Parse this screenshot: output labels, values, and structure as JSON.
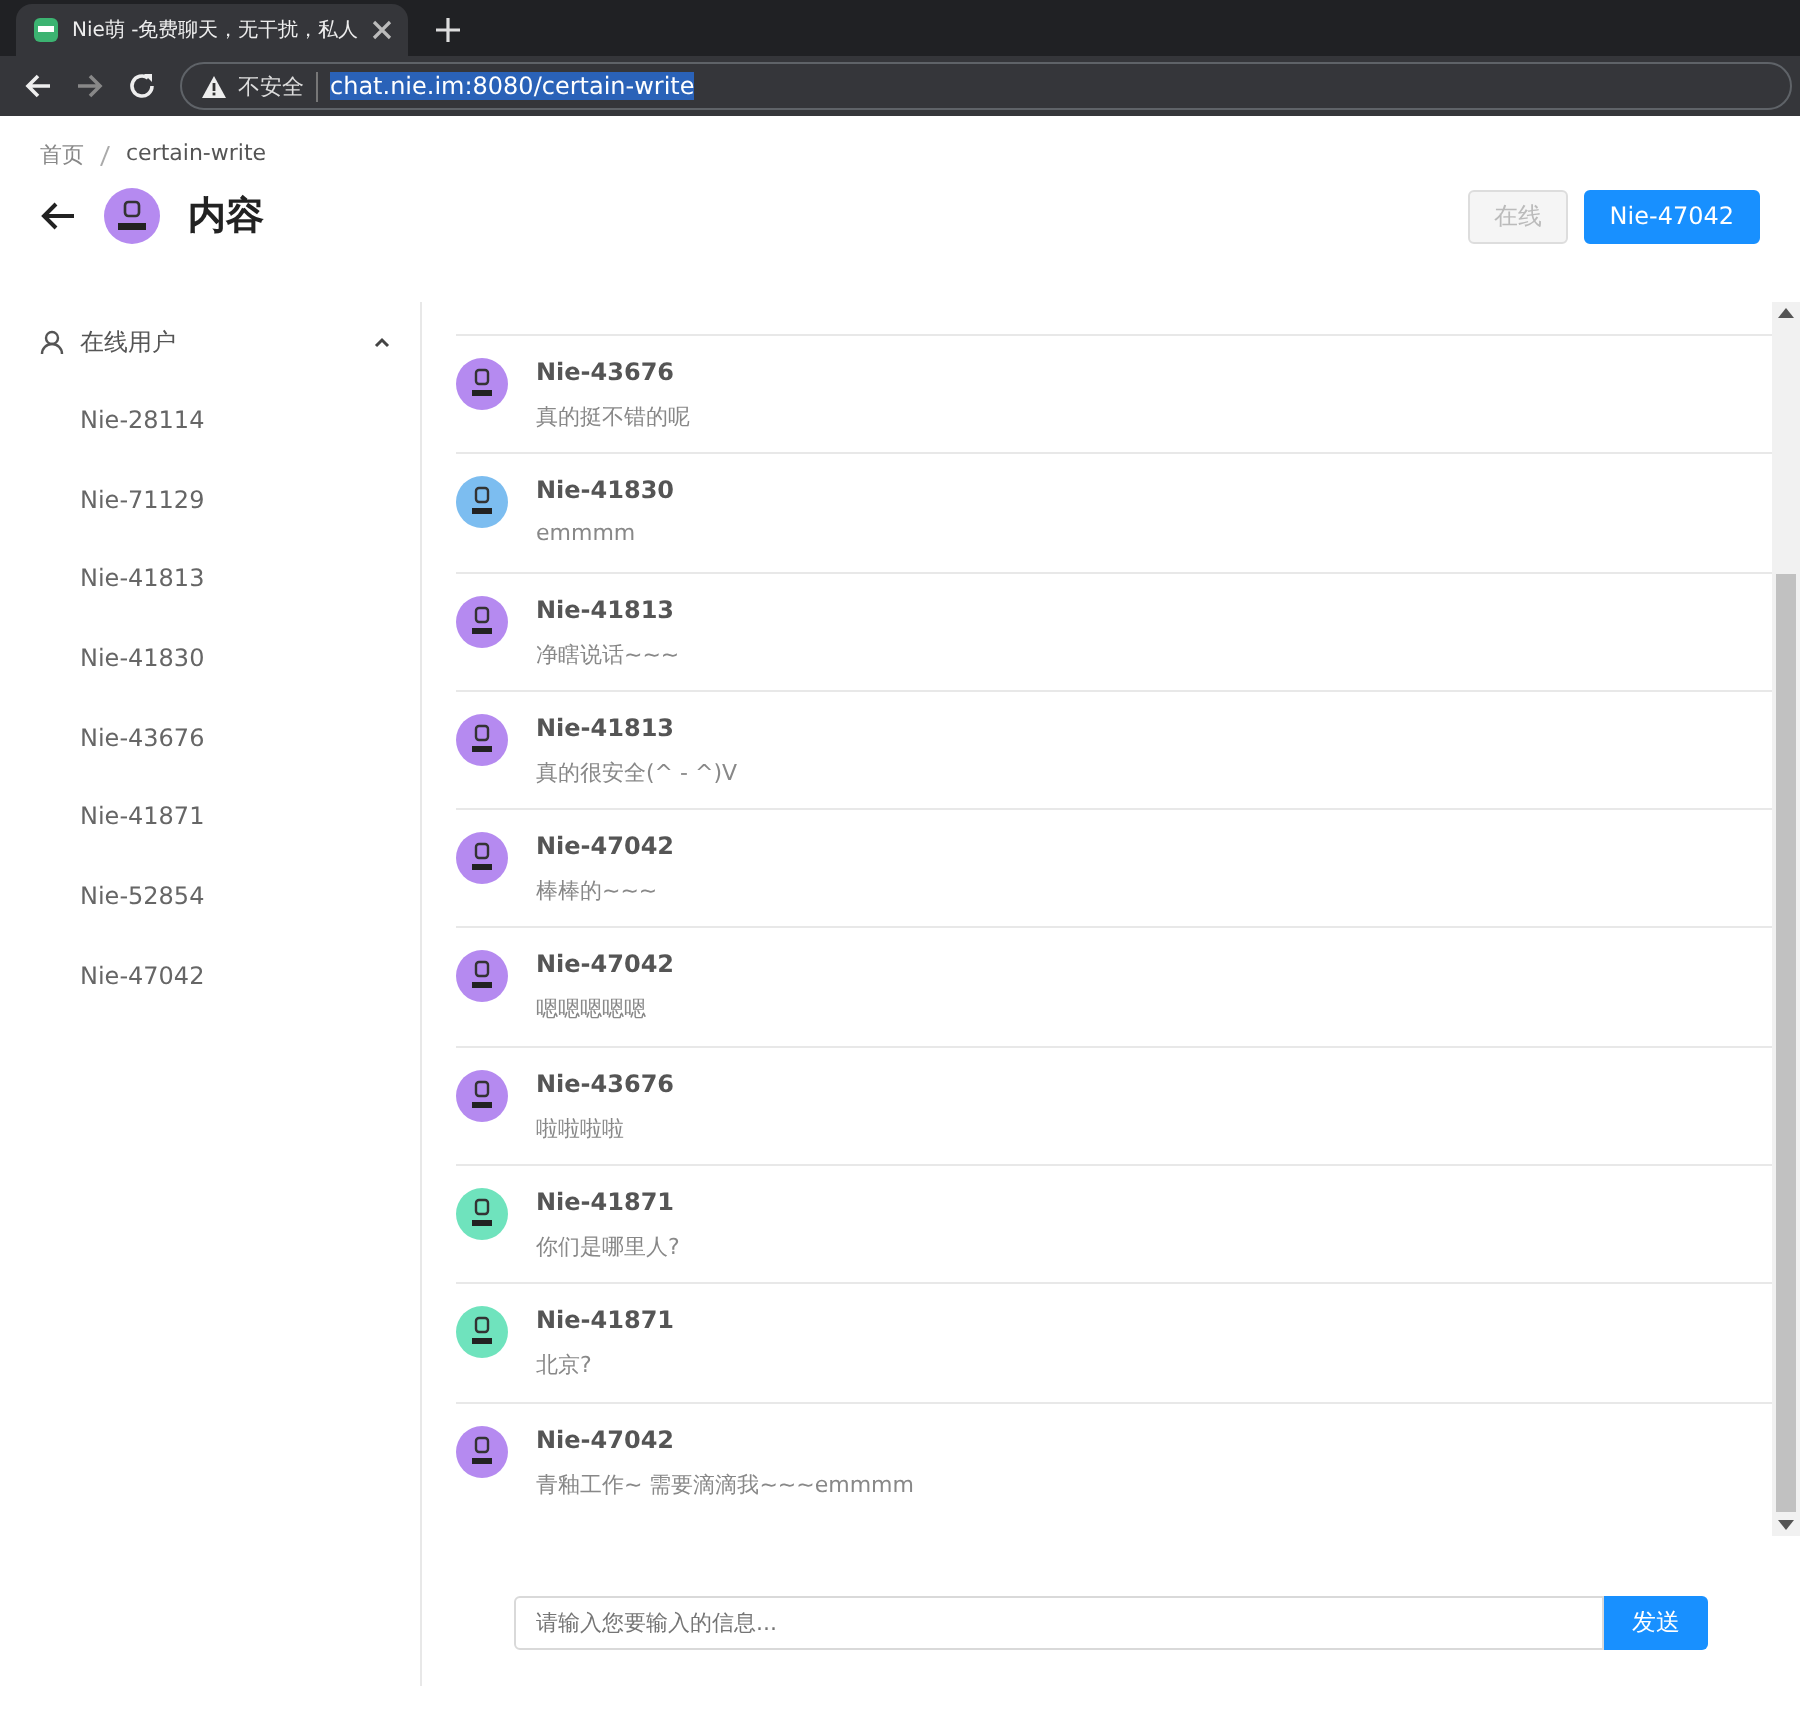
{
  "browser": {
    "tab_title": "Nie萌 -免费聊天，无干扰，私人",
    "security_label": "不安全",
    "url": "chat.nie.im:8080/certain-write"
  },
  "breadcrumb": [
    "首页",
    "certain-write"
  ],
  "header": {
    "title": "内容",
    "buttons": [
      {
        "label": "在线",
        "disabled": true
      },
      {
        "label": "Nie-47042",
        "disabled": false
      }
    ]
  },
  "sidebar": {
    "group": "在线用户",
    "expanded": true,
    "items": [
      "Nie-28114",
      "Nie-71129",
      "Nie-41813",
      "Nie-41830",
      "Nie-43676",
      "Nie-41871",
      "Nie-52854",
      "Nie-47042"
    ]
  },
  "messages": [
    {
      "user": "Nie-43676",
      "text": "真的挺不错的呢",
      "color": "#b58af0"
    },
    {
      "user": "Nie-41830",
      "text": "emmmm",
      "color": "#7cbdf0"
    },
    {
      "user": "Nie-41813",
      "text": "净瞎说话~~~",
      "color": "#b58af0"
    },
    {
      "user": "Nie-41813",
      "text": "真的很安全(^ - ^)V",
      "color": "#b58af0"
    },
    {
      "user": "Nie-47042",
      "text": "棒棒的~~~",
      "color": "#b58af0"
    },
    {
      "user": "Nie-47042",
      "text": "嗯嗯嗯嗯嗯",
      "color": "#b58af0"
    },
    {
      "user": "Nie-43676",
      "text": "啦啦啦啦",
      "color": "#b58af0"
    },
    {
      "user": "Nie-41871",
      "text": "你们是哪里人?",
      "color": "#6fe3bd"
    },
    {
      "user": "Nie-41871",
      "text": "北京?",
      "color": "#6fe3bd"
    },
    {
      "user": "Nie-47042",
      "text": "青釉工作~ 需要滴滴我~~~emmmm",
      "color": "#b58af0"
    }
  ],
  "composer": {
    "placeholder": "请输入您要输入的信息...",
    "send": "发送"
  }
}
